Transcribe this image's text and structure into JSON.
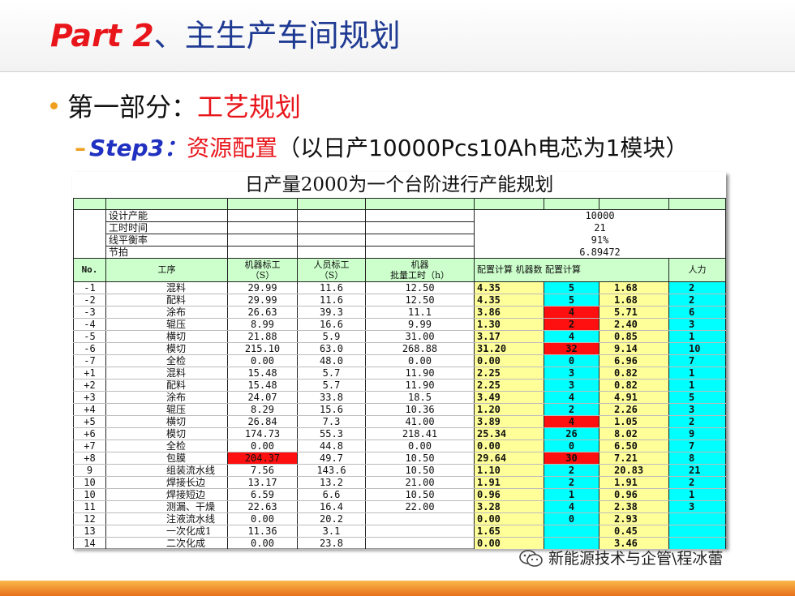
{
  "title": {
    "part": "Part 2",
    "rest": "、主生产车间规划"
  },
  "bullet": {
    "prefix": "第一部分：",
    "highlight": "工艺规划"
  },
  "sub": {
    "step": "Step3：",
    "label": "资源配置",
    "note": "（以日产10000Pcs10Ah电芯为1模块）"
  },
  "sheet": {
    "title": "日产量2000为一个台阶进行产能规划",
    "params": {
      "labels": [
        "设计产能",
        "工时时间",
        "线平衡率",
        "节拍"
      ],
      "values": [
        "10000",
        "21",
        "91%",
        "6.89472"
      ]
    },
    "header": {
      "no": "No.",
      "proc": "工序",
      "machine_std": "机器标工",
      "person_std": "人员标工",
      "unit_s1": "（S）",
      "unit_s2": "（S）",
      "machine": "机器",
      "batch": "批量工时（h）",
      "calc": "配置计算 机器数 配置计算",
      "labor": "人力"
    },
    "rows": [
      {
        "no": "-1",
        "proc": "混料",
        "m": "29.99",
        "p": "11.6",
        "b": "12.50",
        "c1": "4.35",
        "n": "5",
        "c2": "1.68",
        "h": "2"
      },
      {
        "no": "-2",
        "proc": "配料",
        "m": "29.99",
        "p": "11.6",
        "b": "12.50",
        "c1": "4.35",
        "n": "5",
        "c2": "1.68",
        "h": "2"
      },
      {
        "no": "-3",
        "proc": "涂布",
        "m": "26.63",
        "p": "39.3",
        "b": "11.1",
        "c1": "3.86",
        "n": "4",
        "c2": "5.71",
        "h": "6"
      },
      {
        "no": "-4",
        "proc": "辊压",
        "m": "8.99",
        "p": "16.6",
        "b": "9.99",
        "c1": "1.30",
        "n": "2",
        "c2": "2.40",
        "h": "3"
      },
      {
        "no": "-5",
        "proc": "横切",
        "m": "21.88",
        "p": "5.9",
        "b": "31.00",
        "c1": "3.17",
        "n": "4",
        "c2": "0.85",
        "h": "1"
      },
      {
        "no": "-6",
        "proc": "模切",
        "m": "215.10",
        "p": "63.0",
        "b": "268.88",
        "c1": "31.20",
        "n": "32",
        "c2": "9.14",
        "h": "10"
      },
      {
        "no": "-7",
        "proc": "全检",
        "m": "0.00",
        "p": "48.0",
        "b": "0.00",
        "c1": "0.00",
        "n": "0",
        "c2": "6.96",
        "h": "7"
      },
      {
        "no": "+1",
        "proc": "混料",
        "m": "15.48",
        "p": "5.7",
        "b": "11.90",
        "c1": "2.25",
        "n": "3",
        "c2": "0.82",
        "h": "1"
      },
      {
        "no": "+2",
        "proc": "配料",
        "m": "15.48",
        "p": "5.7",
        "b": "11.90",
        "c1": "2.25",
        "n": "3",
        "c2": "0.82",
        "h": "1"
      },
      {
        "no": "+3",
        "proc": "涂布",
        "m": "24.07",
        "p": "33.8",
        "b": "18.5",
        "c1": "3.49",
        "n": "4",
        "c2": "4.91",
        "h": "5"
      },
      {
        "no": "+4",
        "proc": "辊压",
        "m": "8.29",
        "p": "15.6",
        "b": "10.36",
        "c1": "1.20",
        "n": "2",
        "c2": "2.26",
        "h": "3"
      },
      {
        "no": "+5",
        "proc": "横切",
        "m": "26.84",
        "p": "7.3",
        "b": "41.00",
        "c1": "3.89",
        "n": "4",
        "c2": "1.05",
        "h": "2"
      },
      {
        "no": "+6",
        "proc": "模切",
        "m": "174.73",
        "p": "55.3",
        "b": "218.41",
        "c1": "25.34",
        "n": "26",
        "c2": "8.02",
        "h": "9"
      },
      {
        "no": "+7",
        "proc": "全检",
        "m": "0.00",
        "p": "44.8",
        "b": "0.00",
        "c1": "0.00",
        "n": "0",
        "c2": "6.50",
        "h": "7"
      },
      {
        "no": "+8",
        "proc": "包膜",
        "m": "204.37",
        "p": "49.7",
        "b": "10.50",
        "c1": "29.64",
        "n": "30",
        "c2": "7.21",
        "h": "8"
      },
      {
        "no": "9",
        "proc": "组装流水线",
        "m": "7.56",
        "p": "143.6",
        "b": "10.50",
        "c1": "1.10",
        "n": "2",
        "c2": "20.83",
        "h": "21"
      },
      {
        "no": "10",
        "proc": "焊接长边",
        "m": "13.17",
        "p": "13.2",
        "b": "21.00",
        "c1": "1.91",
        "n": "2",
        "c2": "1.91",
        "h": "2"
      },
      {
        "no": "10",
        "proc": "焊接短边",
        "m": "6.59",
        "p": "6.6",
        "b": "10.50",
        "c1": "0.96",
        "n": "1",
        "c2": "0.96",
        "h": "1"
      },
      {
        "no": "11",
        "proc": "测漏、干燥",
        "m": "22.63",
        "p": "16.4",
        "b": "22.00",
        "c1": "3.28",
        "n": "4",
        "c2": "2.38",
        "h": "3"
      },
      {
        "no": "12",
        "proc": "注液流水线",
        "m": "0.00",
        "p": "20.2",
        "b": "",
        "c1": "0.00",
        "n": "0",
        "c2": "2.93",
        "h": ""
      },
      {
        "no": "13",
        "proc": "一次化成1",
        "m": "11.36",
        "p": "3.1",
        "b": "",
        "c1": "1.65",
        "n": "",
        "c2": "0.45",
        "h": ""
      },
      {
        "no": "14",
        "proc": "二次化成",
        "m": "0.00",
        "p": "23.8",
        "b": "",
        "c1": "0.00",
        "n": "",
        "c2": "3.46",
        "h": ""
      }
    ]
  },
  "watermark": "新能源技术与企管\\程冰蕾",
  "colors": {
    "title_red": "#e8151b",
    "title_blue": "#1f3a93",
    "header_green": "#ccffcc",
    "calc_yellow": "#ffff99",
    "count_cyan": "#00ffff",
    "alert_red": "#ff1010",
    "band_orange": "#f0a020"
  }
}
